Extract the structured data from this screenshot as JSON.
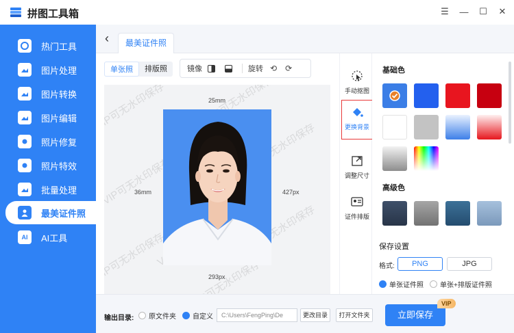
{
  "app": {
    "title": "拼图工具箱"
  },
  "window": {
    "icons": [
      "minimize-icon",
      "maximize-icon",
      "close-icon",
      "hamburger-menu-icon"
    ]
  },
  "sidebar": {
    "items": [
      {
        "label": "热门工具",
        "icon": "hot-tools-icon"
      },
      {
        "label": "图片处理",
        "icon": "image-process-icon"
      },
      {
        "label": "图片转换",
        "icon": "image-convert-icon"
      },
      {
        "label": "图片编辑",
        "icon": "image-edit-icon"
      },
      {
        "label": "照片修复",
        "icon": "photo-repair-icon"
      },
      {
        "label": "照片特效",
        "icon": "photo-effect-icon"
      },
      {
        "label": "批量处理",
        "icon": "batch-icon"
      },
      {
        "label": "最美证件照",
        "icon": "id-photo-icon",
        "active": true
      },
      {
        "label": "AI工具",
        "icon": "ai-icon"
      }
    ]
  },
  "tabs": {
    "active": "最美证件照"
  },
  "editor": {
    "mode_single": "单张照",
    "mode_layout": "排版照",
    "mirror_label": "镜像",
    "rotate_label": "旋转",
    "dim_top": "25mm",
    "dim_left": "36mm",
    "dim_right": "427px",
    "dim_bottom": "293px",
    "watermark": "VIP可无水印保存"
  },
  "right_tools": [
    {
      "label": "手动抠图",
      "icon": "cursor-cutout-icon"
    },
    {
      "label": "更换背景",
      "icon": "paint-bucket-icon",
      "selected": true
    },
    {
      "label": "调整尺寸",
      "icon": "resize-icon"
    },
    {
      "label": "证件排版",
      "icon": "id-card-icon"
    }
  ],
  "panel": {
    "basic_title": "基础色",
    "advanced_title": "高级色",
    "save_settings": "保存设置",
    "format_label": "格式:",
    "format_png": "PNG",
    "format_jpg": "JPG",
    "opt_single": "单张证件照",
    "opt_both": "单张+排版证件照",
    "basic_colors": [
      "#3b7ee6",
      "#2360ee",
      "#e8151f",
      "#c70010",
      "#ffffff",
      "#c3c3c3",
      "blue-gradient",
      "red-gradient",
      "gray-gradient",
      "rainbow-gradient"
    ],
    "advanced_colors": [
      "#2f3e55",
      "#8d8d8d",
      "#2e5f86",
      "#8aa9c9"
    ]
  },
  "bottom": {
    "output_label": "输出目录:",
    "opt_source": "原文件夹",
    "opt_custom": "自定义",
    "path": "C:\\Users\\FengPing\\De",
    "change_btn": "更改目录",
    "open_btn": "打开文件夹",
    "save_btn": "立即保存",
    "vip_badge": "VIP"
  },
  "colors": {
    "accent": "#2f82f5",
    "highlight": "#e83838"
  }
}
